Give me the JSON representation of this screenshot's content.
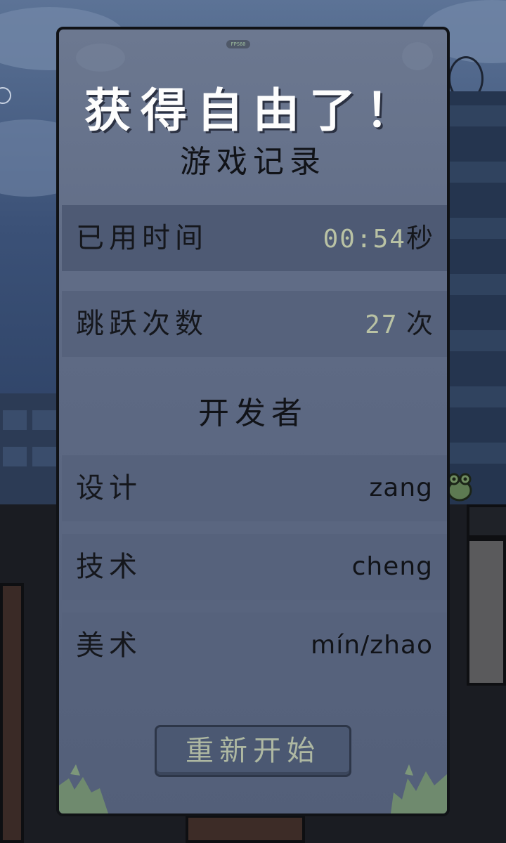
{
  "overlay": {
    "fps_label": "FPS60",
    "title": "获得自由了！",
    "record_heading": "游戏记录",
    "stats": [
      {
        "label": "已用时间",
        "value": "00:54",
        "unit": "秒"
      },
      {
        "label": "跳跃次数",
        "value": "27",
        "unit": "次"
      }
    ],
    "dev_heading": "开发者",
    "credits": [
      {
        "label": "设计",
        "name": "zang"
      },
      {
        "label": "技术",
        "name": "cheng"
      },
      {
        "label": "美术",
        "name": "mín/zhao"
      }
    ],
    "restart_label": "重新开始"
  },
  "colors": {
    "panel": "#5f6b85",
    "highlight_row": "#4e5a74",
    "number": "#b9c2a4",
    "title": "#fdfdfd"
  }
}
